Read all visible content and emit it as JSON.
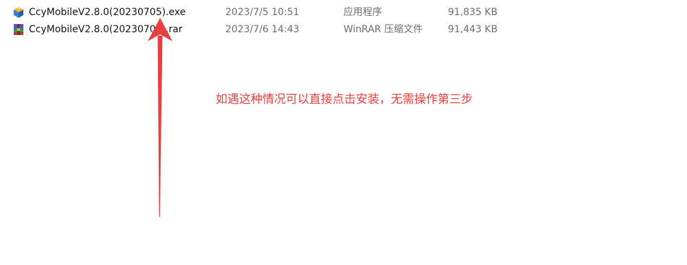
{
  "files": [
    {
      "name": "CcyMobileV2.8.0(20230705).exe",
      "date_modified": "2023/7/5 10:51",
      "type": "应用程序",
      "size": "91,835 KB",
      "icon": "installer-icon"
    },
    {
      "name": "CcyMobileV2.8.0(20230706).rar",
      "date_modified": "2023/7/6 14:43",
      "type": "WinRAR 压缩文件",
      "size": "91,443 KB",
      "icon": "winrar-archive-icon"
    }
  ],
  "annotation": {
    "text": "如遇这种情况可以直接点击安装，无需操作第三步",
    "color": "#e8403f"
  },
  "arrow": {
    "color": "#e8403f",
    "direction": "up"
  }
}
